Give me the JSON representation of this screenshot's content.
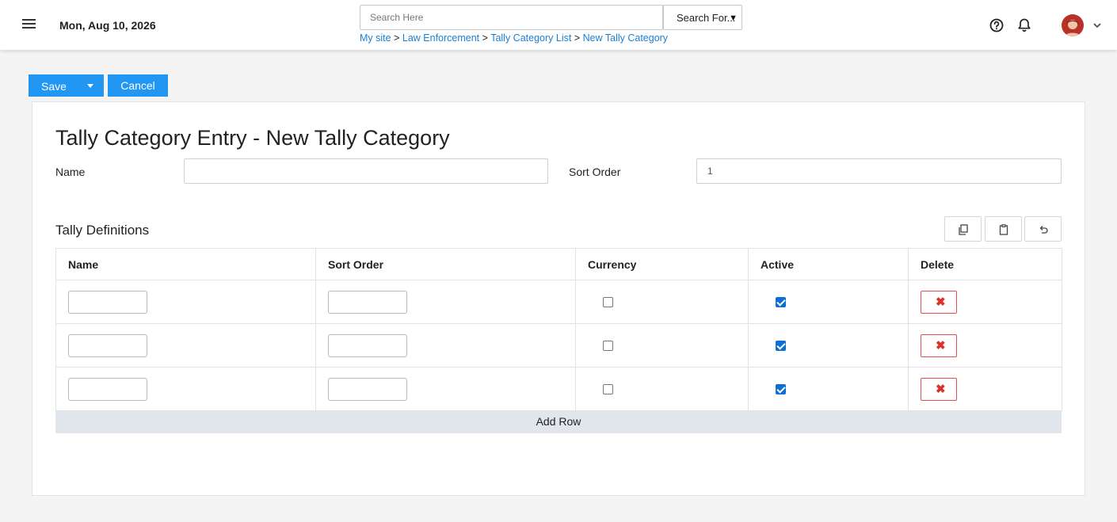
{
  "header": {
    "date": "Mon, Aug 10, 2026",
    "search_placeholder": "Search Here",
    "search_scope": "Search For...",
    "breadcrumb": [
      "My site",
      "Law Enforcement",
      "Tally Category List",
      "New Tally Category"
    ],
    "breadcrumb_separator": ">"
  },
  "toolbar": {
    "save_label": "Save",
    "cancel_label": "Cancel"
  },
  "form": {
    "title": "Tally Category Entry - New Tally Category",
    "name_label": "Name",
    "name_value": "",
    "sort_order_label": "Sort Order",
    "sort_order_value": "1"
  },
  "definitions": {
    "title": "Tally Definitions",
    "columns": [
      "Name",
      "Sort Order",
      "Currency",
      "Active",
      "Delete"
    ],
    "rows": [
      {
        "name": "",
        "sort_order": "",
        "currency": false,
        "active": true
      },
      {
        "name": "",
        "sort_order": "",
        "currency": false,
        "active": true
      },
      {
        "name": "",
        "sort_order": "",
        "currency": false,
        "active": true
      }
    ],
    "add_row_label": "Add Row"
  },
  "icons": {
    "menu": "hamburger-menu-icon",
    "help": "help-circle-icon",
    "notifications": "bell-icon",
    "user": "avatar",
    "copy": "copy-icon",
    "paste": "clipboard-icon",
    "undo": "undo-icon",
    "delete": "x-icon"
  },
  "colors": {
    "primary": "#2196f3",
    "link": "#1a7fd4",
    "danger": "#d9342b",
    "checkbox": "#0b6fd6"
  }
}
